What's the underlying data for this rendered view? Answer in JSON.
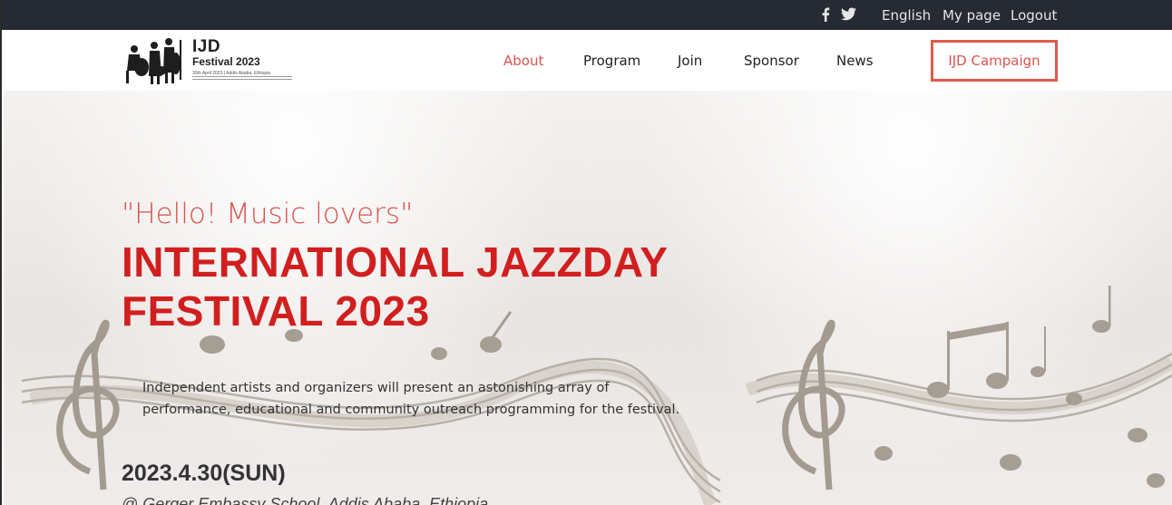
{
  "topbar": {
    "social": [
      "facebook-icon",
      "twitter-icon"
    ],
    "language": "English",
    "my_page": "My page",
    "logout": "Logout"
  },
  "logo": {
    "brand": "IJD",
    "subtitle": "Festival 2023",
    "tagline": "30th April 2023 | Addis Ababa, Ethiopia"
  },
  "nav": {
    "items": [
      {
        "label": "About",
        "active": true
      },
      {
        "label": "Program",
        "active": false
      },
      {
        "label": "Join",
        "active": false
      },
      {
        "label": "Sponsor",
        "active": false
      },
      {
        "label": "News",
        "active": false
      }
    ],
    "campaign": "IJD Campaign"
  },
  "hero": {
    "greeting": "\"Hello! Music lovers\"",
    "title_line1": "INTERNATIONAL JAZZDAY",
    "title_line2": "FESTIVAL 2023",
    "description_line1": "Independent artists and organizers will present an astonishing array of",
    "description_line2": "performance, educational and community outreach programming for the festival.",
    "date": "2023.4.30(SUN)",
    "venue": "@ Gerger Embassy School, Addis Ababa, Ethiopia"
  },
  "colors": {
    "accent": "#d9534f",
    "title_red": "#d11f1f",
    "topbar": "#262a33"
  }
}
